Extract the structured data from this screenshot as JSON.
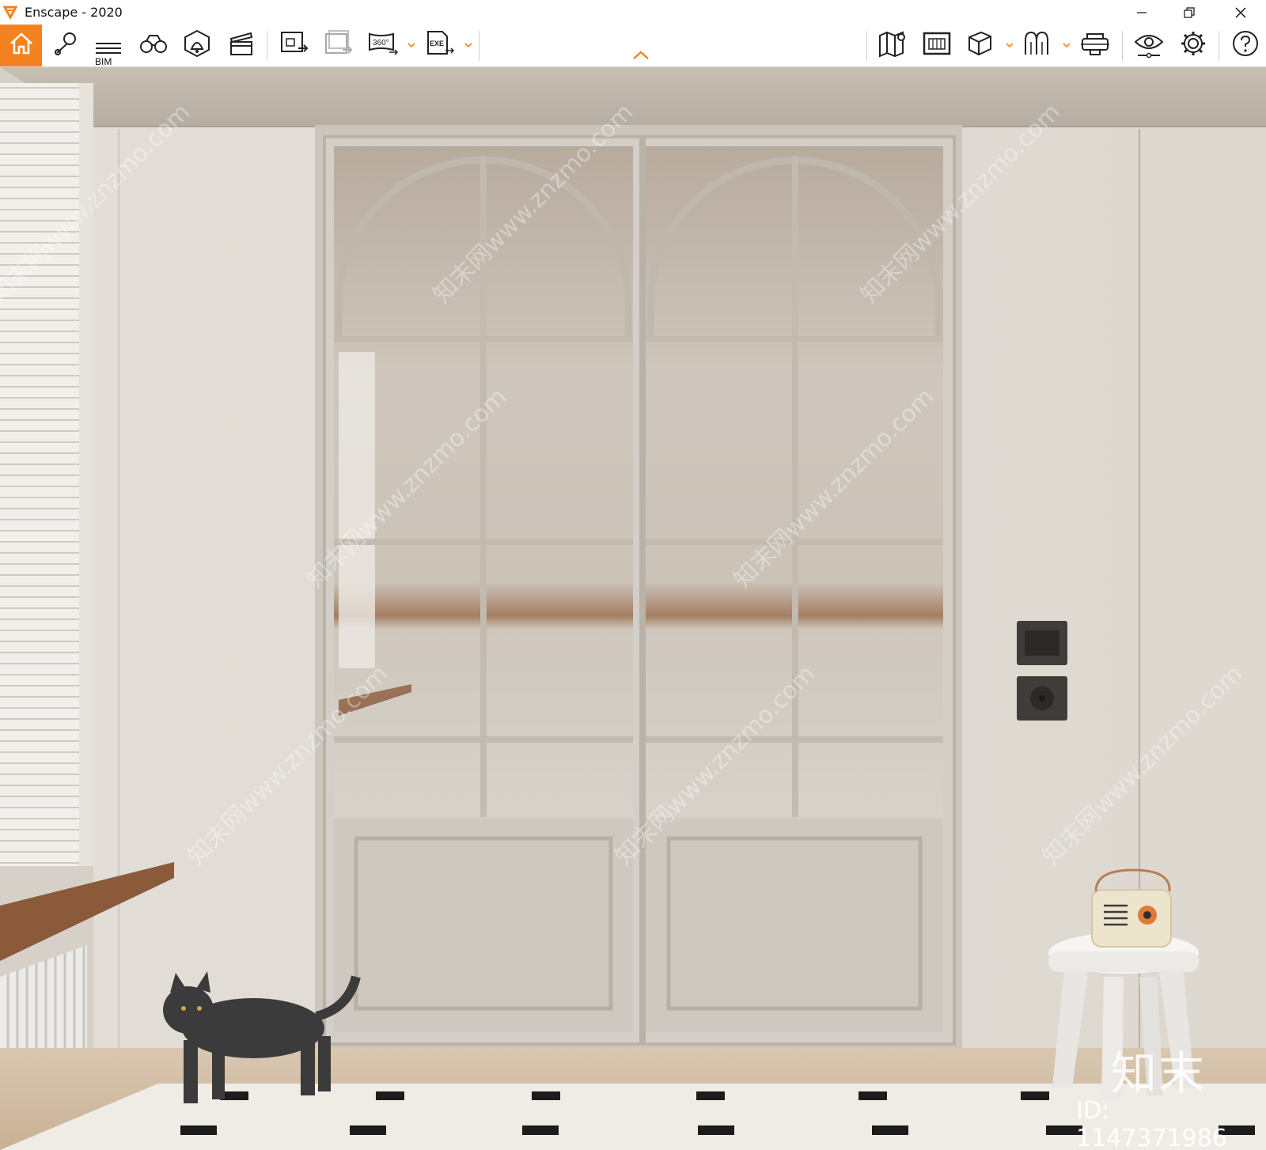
{
  "window": {
    "title": "Enscape - 2020",
    "minimize_label": "—",
    "restore_label": "❐",
    "close_label": "✕"
  },
  "toolbar": {
    "bim_label": "BIM",
    "accent_color": "#f58220",
    "left_tools": [
      "home-icon",
      "pin-icon",
      "bim-icon",
      "binoculars-icon",
      "bell-icon",
      "clapper-icon",
      "export-image-icon",
      "export-batch-icon",
      "panorama-360-icon",
      "export-exe-icon"
    ],
    "right_tools": [
      "map-icon",
      "asset-library-icon",
      "cube-icon",
      "material-icon",
      "vr-headset-icon",
      "eye-settings-icon",
      "gear-icon",
      "help-icon"
    ],
    "pano_label": "360°",
    "exe_label": "EXE"
  },
  "viewport": {
    "watermark_logo": "知末",
    "watermark_id": "ID: 1147371986",
    "watermark_tile": "知末网www.znzmo.com"
  }
}
